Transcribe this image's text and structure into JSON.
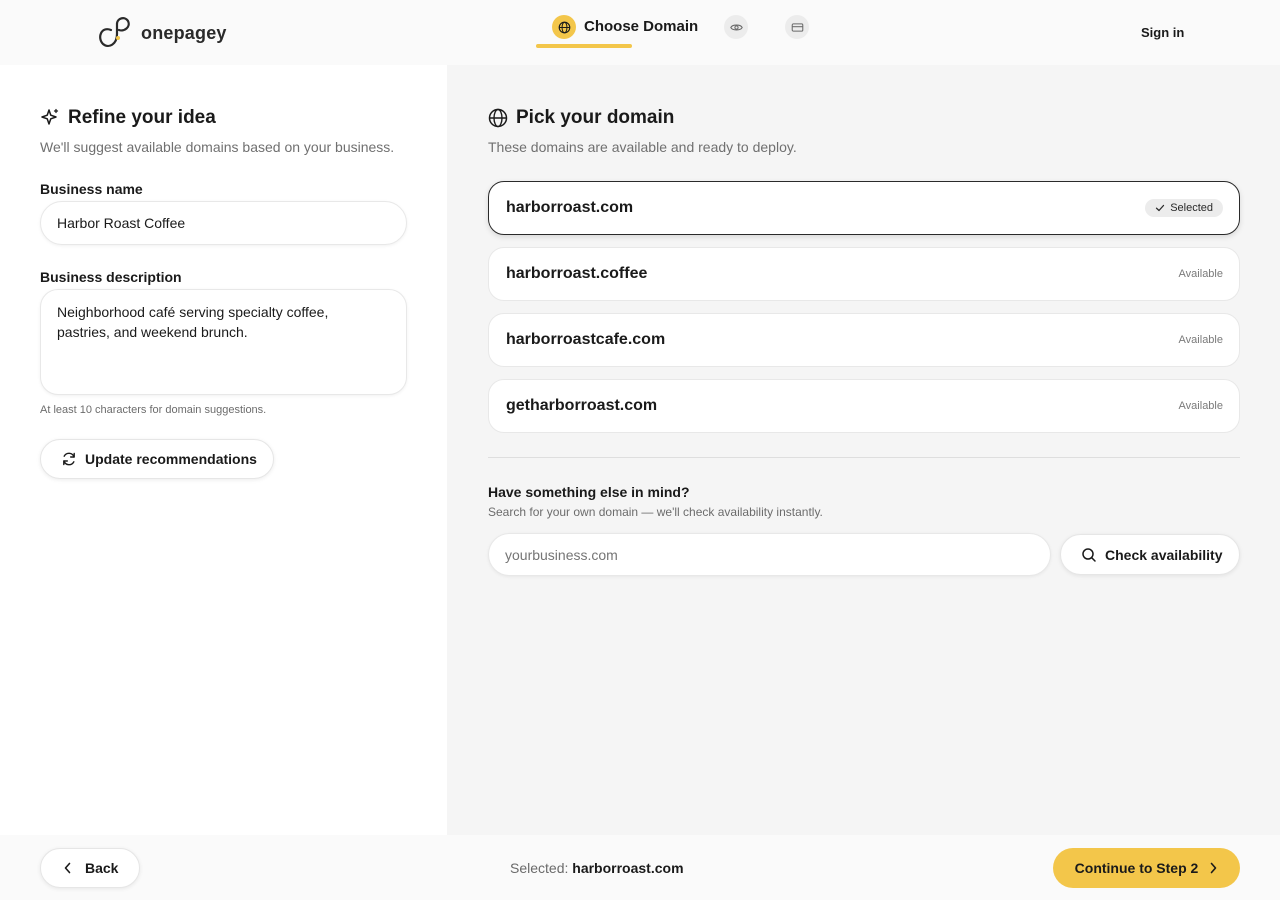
{
  "header": {
    "logo_text": "onepagey",
    "active_step_label": "Choose Domain",
    "sign_in_label": "Sign in"
  },
  "left": {
    "title": "Refine your idea",
    "subtitle": "We'll suggest available domains based on your business.",
    "business_name_label": "Business name",
    "business_name_value": "Harbor Roast Coffee",
    "business_description_label": "Business description",
    "business_description_line1": "Neighborhood café serving specialty coffee,",
    "business_description_line2": "pastries, and weekend brunch.",
    "hint": "At least 10 characters for domain suggestions.",
    "update_button_label": "Update recommendations"
  },
  "right": {
    "title": "Pick your domain",
    "subtitle": "These domains are available and ready to deploy.",
    "domains": [
      {
        "name": "harborroast.com",
        "status": "Selected"
      },
      {
        "name": "harborroast.coffee",
        "status": "Available"
      },
      {
        "name": "harborroastcafe.com",
        "status": "Available"
      },
      {
        "name": "getharborroast.com",
        "status": "Available"
      }
    ],
    "custom_title": "Have something else in mind?",
    "custom_subtitle": "Search for your own domain — we'll check availability instantly.",
    "search_placeholder": "yourbusiness.com",
    "check_button_label": "Check availability"
  },
  "footer": {
    "back_label": "Back",
    "selected_prefix": "Selected:",
    "selected_domain": "harborroast.com",
    "continue_label": "Continue to Step 2"
  },
  "colors": {
    "accent": "#f3c64a",
    "panel_bg": "#f5f5f5"
  }
}
